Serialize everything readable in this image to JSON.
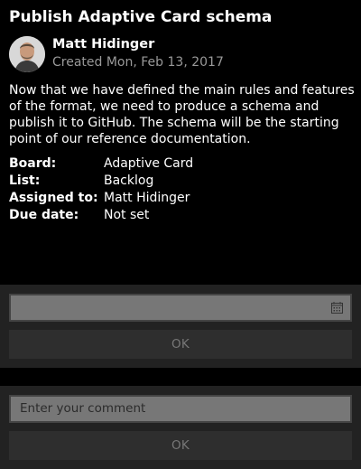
{
  "card": {
    "title": "Publish Adaptive Card schema",
    "author": "Matt Hidinger",
    "created": "Created Mon, Feb 13, 2017",
    "description": "Now that we have defined the main rules and features of the format, we need to produce a schema and publish it to GitHub. The schema will be the starting point of our reference documentation.",
    "facts": [
      {
        "key": "Board:",
        "value": "Adaptive Card"
      },
      {
        "key": "List:",
        "value": "Backlog"
      },
      {
        "key": "Assigned to:",
        "value": "Matt Hidinger"
      },
      {
        "key": "Due date:",
        "value": "Not set"
      }
    ]
  },
  "due_date_action": {
    "input_value": "",
    "icon": "calendar-icon",
    "ok_label": "OK"
  },
  "comment_action": {
    "placeholder": "Enter your comment",
    "ok_label": "OK"
  },
  "colors": {
    "background": "#000000",
    "panel": "#222222",
    "input": "#777777",
    "button": "#2e2e2e",
    "muted_text": "#999999"
  }
}
